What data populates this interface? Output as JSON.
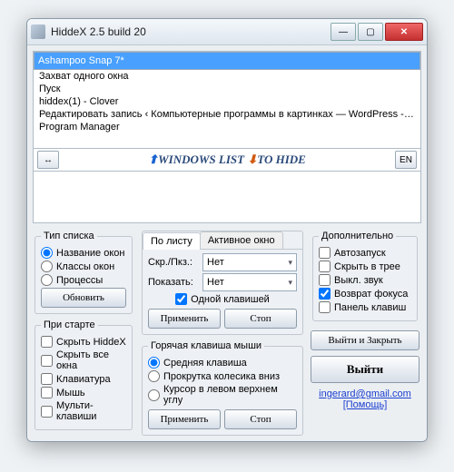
{
  "window": {
    "title": "HiddeX 2.5 build 20"
  },
  "list": {
    "items": [
      "Ashampoo Snap 7*",
      "Захват одного окна",
      "Пуск",
      "hiddex(1) - Clover",
      "Редактировать запись ‹ Компьютерные программы в картинках — WordPress - Moz",
      "Program Manager"
    ]
  },
  "banner": {
    "left": "WINDOWS LIST",
    "right": "TO HIDE",
    "lang": "EN"
  },
  "listType": {
    "legend": "Тип списка",
    "opts": [
      "Название окон",
      "Классы окон",
      "Процессы"
    ],
    "refresh": "Обновить"
  },
  "atStart": {
    "legend": "При старте",
    "opts": [
      "Скрыть HiddeX",
      "Скрыть все окна",
      "Клавиатура",
      "Мышь",
      "Мульти-клавиши"
    ]
  },
  "center": {
    "tabs": [
      "По листу",
      "Активное окно"
    ],
    "hideLabel": "Скр./Пкз.:",
    "hideVal": "Нет",
    "showLabel": "Показать:",
    "showVal": "Нет",
    "oneKey": "Одной клавишей",
    "apply": "Применить",
    "stop": "Стоп"
  },
  "mouse": {
    "legend": "Горячая клавиша мыши",
    "opts": [
      "Средняя клавиша",
      "Прокрутка колесика вниз",
      "Курсор в левом верхнем углу"
    ],
    "apply": "Применить",
    "stop": "Стоп"
  },
  "extra": {
    "legend": "Дополнительно",
    "opts": [
      "Автозапуск",
      "Скрыть в трее",
      "Выкл. звук",
      "Возврат фокуса",
      "Панель клавиш"
    ],
    "checked": [
      false,
      false,
      false,
      true,
      false
    ]
  },
  "actions": {
    "exitClose": "Выйти и Закрыть",
    "exit": "Выйти",
    "email": "ingerard@gmail.com",
    "help": "[Помощь]"
  }
}
